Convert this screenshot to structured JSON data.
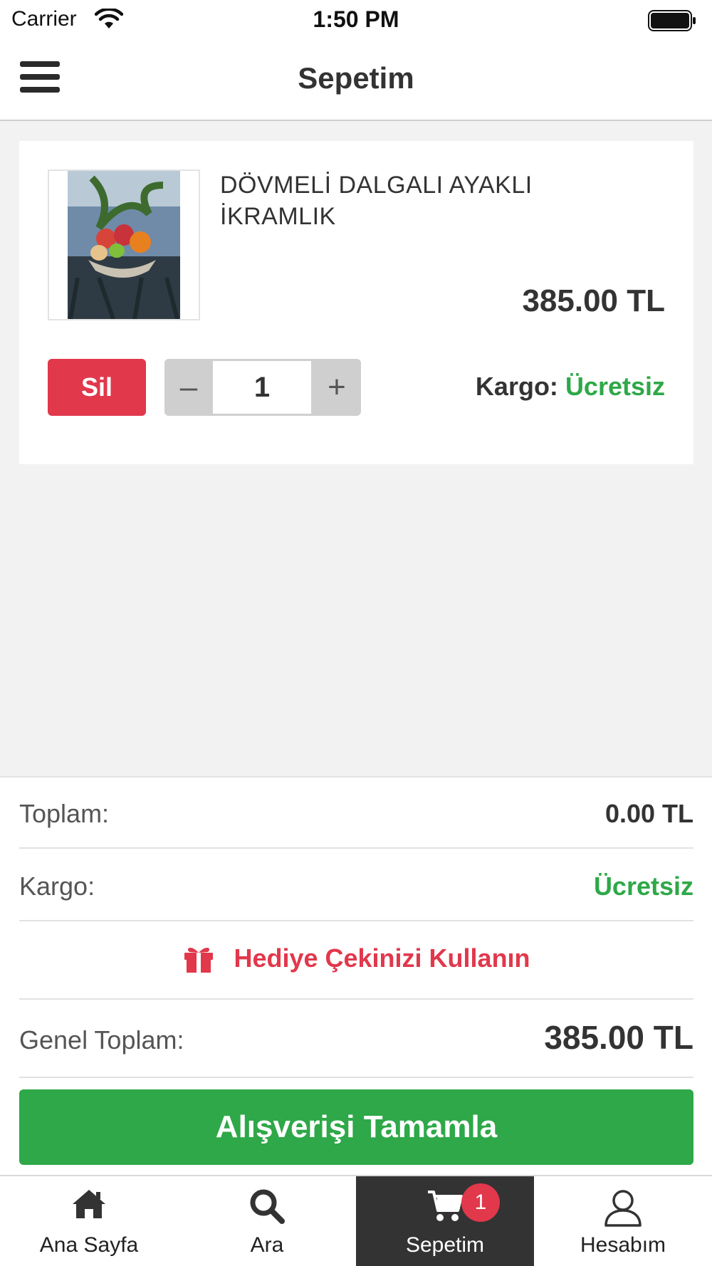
{
  "status_bar": {
    "carrier": "Carrier",
    "time": "1:50 PM"
  },
  "nav": {
    "title": "Sepetim"
  },
  "cart_item": {
    "name": "DÖVMELİ DALGALI AYAKLI İKRAMLIK",
    "price": "385.00 TL",
    "delete_label": "Sil",
    "quantity": "1",
    "decrement_label": "–",
    "increment_label": "+",
    "shipping_label": "Kargo:",
    "shipping_value": "Ücretsiz"
  },
  "summary": {
    "total_label": "Toplam:",
    "total_value": "0.00 TL",
    "shipping_label": "Kargo:",
    "shipping_value": "Ücretsiz",
    "gift_label": "Hediye Çekinizi Kullanın",
    "grand_total_label": "Genel Toplam:",
    "grand_total_value": "385.00 TL",
    "checkout_label": "Alışverişi Tamamla"
  },
  "tab_bar": {
    "tabs": [
      {
        "label": "Ana Sayfa",
        "icon": "home-icon"
      },
      {
        "label": "Ara",
        "icon": "search-icon"
      },
      {
        "label": "Sepetim",
        "icon": "cart-icon",
        "active": true,
        "badge": "1"
      },
      {
        "label": "Hesabım",
        "icon": "user-icon"
      }
    ]
  },
  "colors": {
    "accent_red": "#e1384c",
    "accent_green": "#2ea848",
    "active_tab_bg": "#333333"
  }
}
